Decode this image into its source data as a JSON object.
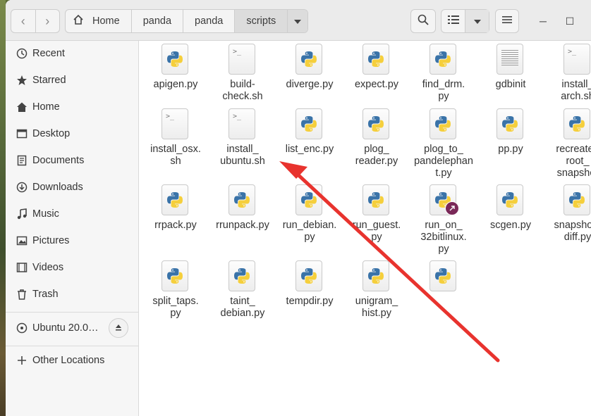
{
  "header": {
    "breadcrumbs": [
      "Home",
      "panda",
      "panda",
      "scripts"
    ]
  },
  "sidebar": {
    "items": [
      {
        "label": "Recent",
        "icon": "clock-icon"
      },
      {
        "label": "Starred",
        "icon": "star-icon"
      },
      {
        "label": "Home",
        "icon": "home-icon"
      },
      {
        "label": "Desktop",
        "icon": "desktop-icon"
      },
      {
        "label": "Documents",
        "icon": "documents-icon"
      },
      {
        "label": "Downloads",
        "icon": "download-icon"
      },
      {
        "label": "Music",
        "icon": "music-icon"
      },
      {
        "label": "Pictures",
        "icon": "pictures-icon"
      },
      {
        "label": "Videos",
        "icon": "videos-icon"
      },
      {
        "label": "Trash",
        "icon": "trash-icon"
      }
    ],
    "device": {
      "label": "Ubuntu 20.0…",
      "icon": "drive-icon"
    },
    "other": {
      "label": "Other Locations",
      "icon": "plus-icon"
    }
  },
  "files": [
    {
      "name": "apigen.py",
      "type": "python"
    },
    {
      "name": "build-\ncheck.sh",
      "type": "script"
    },
    {
      "name": "diverge.py",
      "type": "python"
    },
    {
      "name": "expect.py",
      "type": "python"
    },
    {
      "name": "find_drm.\npy",
      "type": "python"
    },
    {
      "name": "gdbinit",
      "type": "text"
    },
    {
      "name": "install_\narch.sh",
      "type": "script"
    },
    {
      "name": "install_osx.\nsh",
      "type": "script"
    },
    {
      "name": "install_\nubuntu.sh",
      "type": "script"
    },
    {
      "name": "list_enc.py",
      "type": "python"
    },
    {
      "name": "plog_\nreader.py",
      "type": "python"
    },
    {
      "name": "plog_to_\npandelephan\nt.py",
      "type": "python"
    },
    {
      "name": "pp.py",
      "type": "python"
    },
    {
      "name": "recreate_\nroot_\nsnapshot",
      "type": "python"
    },
    {
      "name": "rrpack.py",
      "type": "python"
    },
    {
      "name": "rrunpack.py",
      "type": "python"
    },
    {
      "name": "run_debian.\npy",
      "type": "python"
    },
    {
      "name": "run_guest.\npy",
      "type": "python"
    },
    {
      "name": "run_on_\n32bitlinux.\npy",
      "type": "python-link"
    },
    {
      "name": "scgen.py",
      "type": "python"
    },
    {
      "name": "snapshot_\ndiff.py",
      "type": "python"
    },
    {
      "name": "split_taps.\npy",
      "type": "python"
    },
    {
      "name": "taint_\ndebian.py",
      "type": "python"
    },
    {
      "name": "tempdir.py",
      "type": "python"
    },
    {
      "name": "unigram_\nhist.py",
      "type": "python"
    },
    {
      "name": "",
      "type": "python"
    }
  ],
  "colors": {
    "annotation_arrow": "#e8332e",
    "python_blue": "#3a73a8",
    "python_yellow": "#f5cf3c",
    "link_badge": "#7a2858"
  }
}
